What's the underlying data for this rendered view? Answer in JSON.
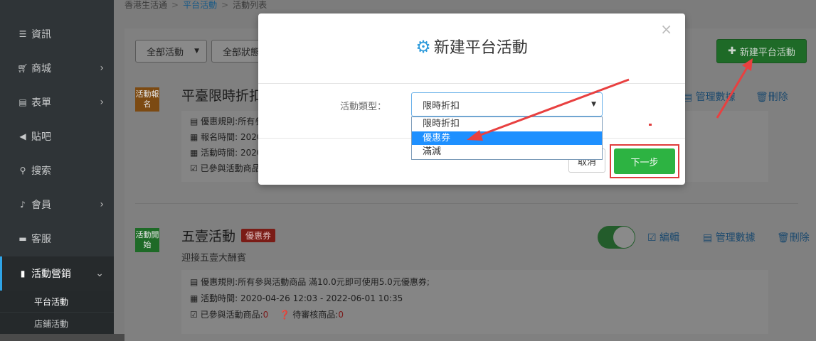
{
  "breadcrumb": [
    "香港生活通",
    "平台活動",
    "活動列表"
  ],
  "sidebar": {
    "items": [
      {
        "label": "資訊",
        "icon": "list-icon"
      },
      {
        "label": "商城",
        "icon": "cart-icon"
      },
      {
        "label": "表單",
        "icon": "form-icon"
      },
      {
        "label": "貼吧",
        "icon": "megaphone-icon"
      },
      {
        "label": "搜索",
        "icon": "search-icon"
      },
      {
        "label": "會員",
        "icon": "bell-icon"
      },
      {
        "label": "客服",
        "icon": "chat-icon"
      },
      {
        "label": "活動營銷",
        "icon": "bookmark-icon"
      }
    ],
    "subitems": [
      "平台活動",
      "店鋪活動"
    ]
  },
  "filters": [
    "全部活動",
    "全部狀態"
  ],
  "new_button": "新建平台活動",
  "activities": [
    {
      "badge": "活動報名",
      "title": "平臺限時折扣",
      "lines": [
        "優惠規則:所有參",
        "報名時間: 2020",
        "活動時間: 2020",
        "已參與活動商品"
      ],
      "ops": [
        "管理數據",
        "刪除"
      ]
    },
    {
      "badge": "活動開始",
      "title": "五壹活動",
      "tag": "優惠券",
      "subtitle": "迎接五壹大酬賓",
      "lines": [
        "優惠規則:所有參與活動商品 滿10.0元即可使用5.0元優惠券;",
        "活動時間: 2020-04-26 12:03 - 2022-06-01 10:35"
      ],
      "participated_label": "已參與活動商品:",
      "participated_count": "0",
      "pending_label": "待審核商品:",
      "pending_count": "0",
      "ops": [
        "編輯",
        "管理數據",
        "刪除"
      ]
    }
  ],
  "modal": {
    "title": "新建平台活動",
    "field_label": "活動類型：",
    "selected": "限時折扣",
    "options": [
      "限時折扣",
      "優惠券",
      "滿減"
    ],
    "highlighted_option": "優惠券",
    "cancel": "取消",
    "next": "下一步"
  },
  "colors": {
    "accent_green": "#2db342",
    "highlight_blue": "#1e90ff",
    "annotation_red": "#e03c3c",
    "gear_blue": "#2f9bdb"
  }
}
